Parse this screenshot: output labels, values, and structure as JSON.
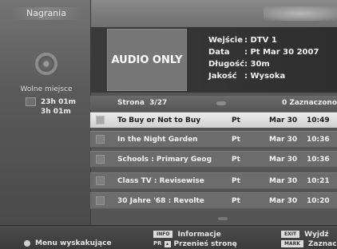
{
  "header": {
    "title": "Nagrania"
  },
  "storage": {
    "label": "Wolne miejsce",
    "times": [
      "23h 01m",
      "3h 01m"
    ]
  },
  "preview": {
    "label": "AUDIO ONLY"
  },
  "info": {
    "rows": [
      {
        "label": "Wejście",
        "value": ": DTV 1"
      },
      {
        "label": "Data",
        "value": ": Pt Mar 30 2007"
      },
      {
        "label": "Długość",
        "value": ": 30m"
      },
      {
        "label": "Jakość",
        "value": ": Wysoka"
      }
    ]
  },
  "list": {
    "page_label": "Strona",
    "page_value": "3/27",
    "selected_count": "0 Zaznaczono",
    "rows": [
      {
        "title": "To Buy or Not to Buy",
        "day": "Pt",
        "date": "Mar 30",
        "time": "10:49",
        "selected": true
      },
      {
        "title": "In the Night Garden",
        "day": "Pt",
        "date": "Mar 30",
        "time": "10:36",
        "selected": false
      },
      {
        "title": "Schools : Primary Geog",
        "day": "Pt",
        "date": "Mar 30",
        "time": "10:36",
        "selected": false
      },
      {
        "title": "Class TV : Revisewise",
        "day": "Pt",
        "date": "Mar 30",
        "time": "10:21",
        "selected": false
      },
      {
        "title": "30 Jahre '68 : Revolte",
        "day": "Pt",
        "date": "Mar 30",
        "time": "10:20",
        "selected": false
      }
    ]
  },
  "footer": {
    "menu": "Menu wyskakujące",
    "info_key": "INFO",
    "info_label": "Informacje",
    "pr_key": "PR",
    "pr_label": "Przenieś stronę",
    "exit_key": "EXIT",
    "exit_label": "Wyjdź",
    "mark_key": "MARK",
    "mark_label": "Zaznacz"
  }
}
